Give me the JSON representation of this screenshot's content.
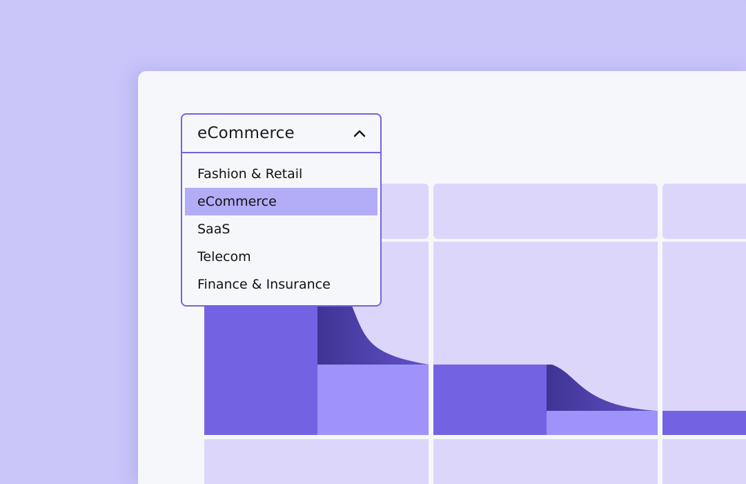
{
  "dropdown": {
    "selected": "eCommerce",
    "expanded": true,
    "options": [
      "Fashion & Retail",
      "eCommerce",
      "SaaS",
      "Telecom",
      "Finance & Insurance"
    ],
    "selected_index": 1
  },
  "colors": {
    "background": "#c9c5f9",
    "card": "#f6f7fb",
    "cell": "#ddd6fb",
    "bar_primary": "#7363e3",
    "bar_secondary": "#9f92f8",
    "flow": "#4f41a8",
    "accent": "#7361de"
  }
}
